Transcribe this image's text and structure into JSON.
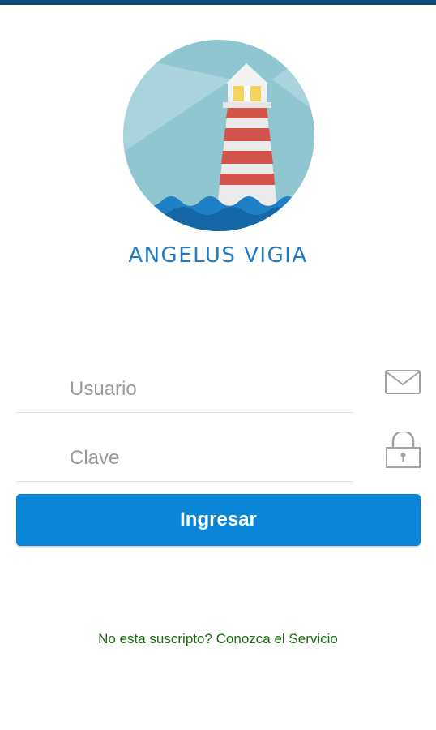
{
  "app": {
    "name": "ANGELUS VIGIA"
  },
  "login": {
    "username_placeholder": "Usuario",
    "password_placeholder": "Clave",
    "username_value": "",
    "password_value": "",
    "submit_label": "Ingresar",
    "subscribe_link": "No esta suscripto? Conozca el Servicio"
  },
  "icons": {
    "logo": "lighthouse-logo",
    "username": "envelope-icon",
    "password": "padlock-icon"
  },
  "colors": {
    "top_bar": "#0d4a7a",
    "brand_text": "#1e7bc4",
    "button": "#0a84d6",
    "link": "#1a6b0f",
    "logo_sky": "#8fc6d0"
  }
}
